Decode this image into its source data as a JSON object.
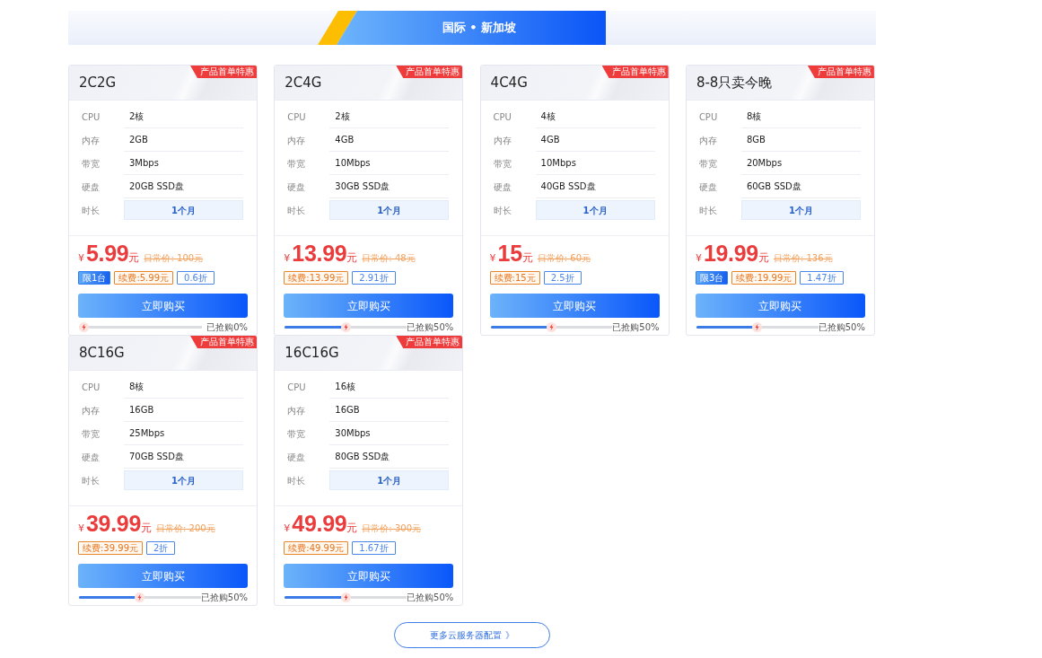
{
  "region_banner": {
    "title": "国际 • 新加坡"
  },
  "plans": [
    {
      "name": "2C2G",
      "badge": "产品首单特惠",
      "specs": [
        {
          "kind": "text",
          "label": "CPU",
          "value": "2核"
        },
        {
          "kind": "text",
          "label": "内存",
          "value": "2GB"
        },
        {
          "kind": "text",
          "label": "带宽",
          "value": "3Mbps"
        },
        {
          "kind": "text",
          "label": "硬盘",
          "value": "20GB SSD盘"
        },
        {
          "kind": "option",
          "label": "时长",
          "value": "1个月"
        }
      ],
      "currency": "¥",
      "price": "5.99",
      "unit": "元",
      "original_price": "日常价: 100元",
      "tags": [
        {
          "kind": "limit",
          "text": "限1台"
        },
        {
          "kind": "renewal",
          "text": "续费:5.99元"
        },
        {
          "kind": "discount",
          "text": "0.6折"
        }
      ],
      "buy_button": "立即购买",
      "sold": {
        "level": 0,
        "label": "已抢购0%"
      }
    },
    {
      "name": "2C4G",
      "badge": "产品首单特惠",
      "specs": [
        {
          "kind": "text",
          "label": "CPU",
          "value": "2核"
        },
        {
          "kind": "text",
          "label": "内存",
          "value": "4GB"
        },
        {
          "kind": "text",
          "label": "带宽",
          "value": "10Mbps"
        },
        {
          "kind": "text",
          "label": "硬盘",
          "value": "30GB SSD盘"
        },
        {
          "kind": "option",
          "label": "时长",
          "value": "1个月"
        }
      ],
      "currency": "¥",
      "price": "13.99",
      "unit": "元",
      "original_price": "日常价: 48元",
      "tags": [
        {
          "kind": "renewal",
          "text": "续费:13.99元"
        },
        {
          "kind": "discount",
          "text": "2.91折"
        }
      ],
      "buy_button": "立即购买",
      "sold": {
        "level": 0.5,
        "label": "已抢购50%"
      }
    },
    {
      "name": "4C4G",
      "badge": "产品首单特惠",
      "specs": [
        {
          "kind": "text",
          "label": "CPU",
          "value": "4核"
        },
        {
          "kind": "text",
          "label": "内存",
          "value": "4GB"
        },
        {
          "kind": "text",
          "label": "带宽",
          "value": "10Mbps"
        },
        {
          "kind": "text",
          "label": "硬盘",
          "value": "40GB SSD盘"
        },
        {
          "kind": "option",
          "label": "时长",
          "value": "1个月"
        }
      ],
      "currency": "¥",
      "price": "15",
      "unit": "元",
      "original_price": "日常价: 60元",
      "tags": [
        {
          "kind": "renewal",
          "text": "续费:15元"
        },
        {
          "kind": "discount",
          "text": "2.5折"
        }
      ],
      "buy_button": "立即购买",
      "sold": {
        "level": 0.5,
        "label": "已抢购50%"
      }
    },
    {
      "name": "8-8只卖今晚",
      "badge": "产品首单特惠",
      "specs": [
        {
          "kind": "text",
          "label": "CPU",
          "value": "8核"
        },
        {
          "kind": "text",
          "label": "内存",
          "value": "8GB"
        },
        {
          "kind": "text",
          "label": "带宽",
          "value": "20Mbps"
        },
        {
          "kind": "text",
          "label": "硬盘",
          "value": "60GB SSD盘"
        },
        {
          "kind": "option",
          "label": "时长",
          "value": "1个月"
        }
      ],
      "currency": "¥",
      "price": "19.99",
      "unit": "元",
      "original_price": "日常价: 136元",
      "tags": [
        {
          "kind": "limit",
          "text": "限3台"
        },
        {
          "kind": "renewal",
          "text": "续费:19.99元"
        },
        {
          "kind": "discount",
          "text": "1.47折"
        }
      ],
      "buy_button": "立即购买",
      "sold": {
        "level": 0.5,
        "label": "已抢购50%"
      }
    },
    {
      "name": "8C16G",
      "badge": "产品首单特惠",
      "specs": [
        {
          "kind": "text",
          "label": "CPU",
          "value": "8核"
        },
        {
          "kind": "text",
          "label": "内存",
          "value": "16GB"
        },
        {
          "kind": "text",
          "label": "带宽",
          "value": "25Mbps"
        },
        {
          "kind": "text",
          "label": "硬盘",
          "value": "70GB SSD盘"
        },
        {
          "kind": "option",
          "label": "时长",
          "value": "1个月"
        }
      ],
      "currency": "¥",
      "price": "39.99",
      "unit": "元",
      "original_price": "日常价: 200元",
      "tags": [
        {
          "kind": "renewal",
          "text": "续费:39.99元"
        },
        {
          "kind": "discount",
          "text": "2折"
        }
      ],
      "buy_button": "立即购买",
      "sold": {
        "level": 0.5,
        "label": "已抢购50%"
      }
    },
    {
      "name": "16C16G",
      "badge": "产品首单特惠",
      "specs": [
        {
          "kind": "text",
          "label": "CPU",
          "value": "16核"
        },
        {
          "kind": "text",
          "label": "内存",
          "value": "16GB"
        },
        {
          "kind": "text",
          "label": "带宽",
          "value": "30Mbps"
        },
        {
          "kind": "text",
          "label": "硬盘",
          "value": "80GB SSD盘"
        },
        {
          "kind": "option",
          "label": "时长",
          "value": "1个月"
        }
      ],
      "currency": "¥",
      "price": "49.99",
      "unit": "元",
      "original_price": "日常价: 300元",
      "tags": [
        {
          "kind": "renewal",
          "text": "续费:49.99元"
        },
        {
          "kind": "discount",
          "text": "1.67折"
        }
      ],
      "buy_button": "立即购买",
      "sold": {
        "level": 0.5,
        "label": "已抢购50%"
      }
    }
  ],
  "more_button": "更多云服务器配置 》"
}
